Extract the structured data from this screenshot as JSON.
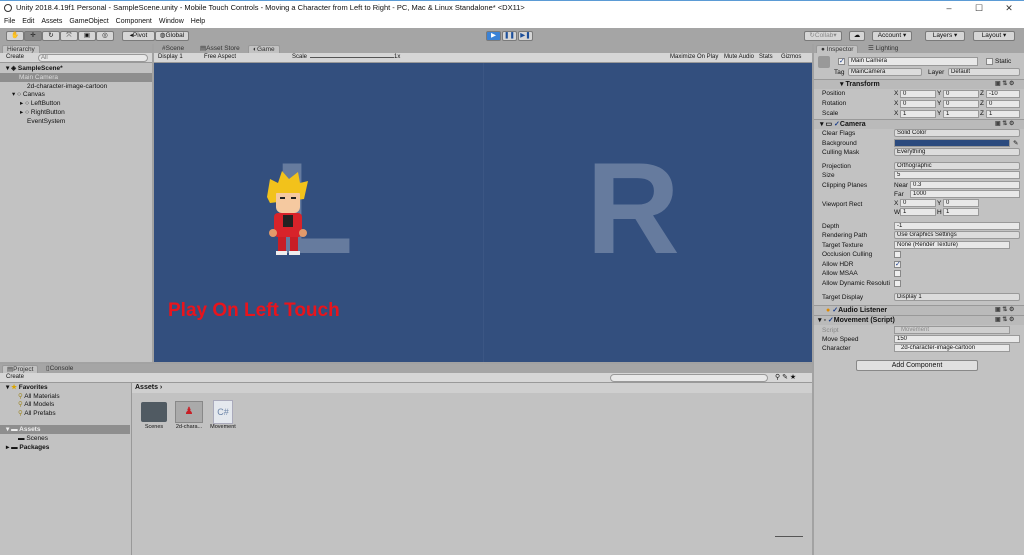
{
  "window": {
    "title": "Unity 2018.4.19f1 Personal - SampleScene.unity - Mobile Touch Controls - Moving a Character from Left to Right - PC, Mac & Linux Standalone* <DX11>",
    "minimize": "–",
    "maximize": "☐",
    "close": "✕"
  },
  "menu": [
    "File",
    "Edit",
    "Assets",
    "GameObject",
    "Component",
    "Window",
    "Help"
  ],
  "toolbar": {
    "pivot": "Pivot",
    "global": "Global",
    "collab": "Collab",
    "account": "Account",
    "layers": "Layers",
    "layout": "Layout"
  },
  "hierarchy": {
    "tab": "Hierarchy",
    "create": "Create",
    "search_placeholder": "All",
    "scene": "SampleScene*",
    "items": [
      "Main Camera",
      "2d-character-image-cartoon",
      "Canvas",
      "LeftButton",
      "RightButton",
      "EventSystem"
    ]
  },
  "game": {
    "tabs": [
      "Scene",
      "Asset Store",
      "Game"
    ],
    "display": "Display 1",
    "aspect": "Free Aspect",
    "scale_label": "Scale",
    "scale_value": "1x",
    "maximize": "Maximize On Play",
    "mute": "Mute Audio",
    "stats": "Stats",
    "gizmos": "Gizmos",
    "letter_left": "L",
    "letter_right": "R",
    "message": "Play On Left Touch",
    "bg_color": "#334f7e",
    "message_color": "#e8141c"
  },
  "project": {
    "tabs": [
      "Project",
      "Console"
    ],
    "create": "Create",
    "favorites": "Favorites",
    "fav_items": [
      "All Materials",
      "All Models",
      "All Prefabs"
    ],
    "assets": "Assets",
    "scenes": "Scenes",
    "packages": "Packages",
    "breadcrumb": "Assets",
    "files": [
      "Scenes",
      "2d-chara...",
      "Movement"
    ],
    "cs_label": "C#"
  },
  "inspector": {
    "tabs": [
      "Inspector",
      "Lighting"
    ],
    "name": "Main Camera",
    "static": "Static",
    "tag_label": "Tag",
    "tag": "MainCamera",
    "layer_label": "Layer",
    "layer": "Default",
    "transform": {
      "title": "Transform",
      "rows": [
        {
          "label": "Position",
          "x": "0",
          "y": "0",
          "z": "-10"
        },
        {
          "label": "Rotation",
          "x": "0",
          "y": "0",
          "z": "0"
        },
        {
          "label": "Scale",
          "x": "1",
          "y": "1",
          "z": "1"
        }
      ]
    },
    "camera": {
      "title": "Camera",
      "clear_flags_label": "Clear Flags",
      "clear_flags": "Solid Color",
      "background_label": "Background",
      "culling_label": "Culling Mask",
      "culling": "Everything",
      "projection_label": "Projection",
      "projection": "Orthographic",
      "size_label": "Size",
      "size": "5",
      "clipping_label": "Clipping Planes",
      "near_label": "Near",
      "near": "0.3",
      "far_label": "Far",
      "far": "1000",
      "viewport_label": "Viewport Rect",
      "vx": "0",
      "vy": "0",
      "vw": "1",
      "vh": "1",
      "depth_label": "Depth",
      "depth": "-1",
      "rendering_label": "Rendering Path",
      "rendering": "Use Graphics Settings",
      "target_tex_label": "Target Texture",
      "target_tex": "None (Render Texture)",
      "occlusion_label": "Occlusion Culling",
      "hdr_label": "Allow HDR",
      "msaa_label": "Allow MSAA",
      "dynres_label": "Allow Dynamic Resoluti",
      "target_display_label": "Target Display",
      "target_display": "Display 1"
    },
    "audio": {
      "title": "Audio Listener"
    },
    "movement": {
      "title": "Movement (Script)",
      "script_label": "Script",
      "script": "Movement",
      "speed_label": "Move Speed",
      "speed": "150",
      "character_label": "Character",
      "character": "2d-character-image-cartoon"
    },
    "add_component": "Add Component"
  }
}
